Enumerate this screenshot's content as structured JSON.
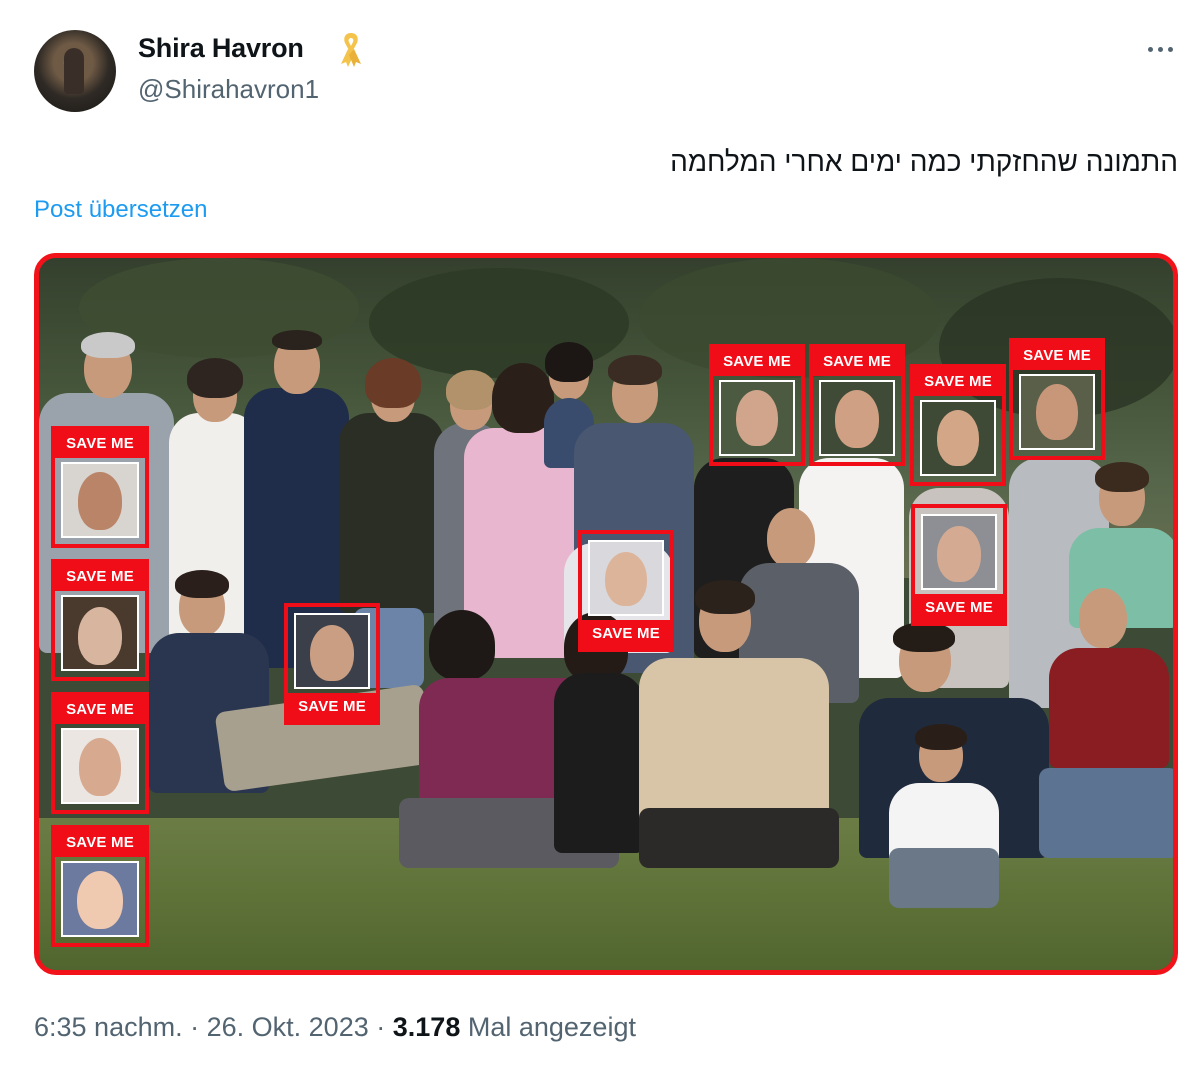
{
  "author": {
    "display_name": "Shira Havron",
    "handle": "@Shirahavron1",
    "badge": "ribbon-icon",
    "badge_color": "#f4c34c"
  },
  "tweet": {
    "text": "התמונה שהחזקתי כמה ימים אחרי המלחמה",
    "translate_label": "Post übersetzen"
  },
  "media": {
    "border_color": "#f2121a",
    "overlay_label": "SAVE ME",
    "overlays": [
      {
        "label": "SAVE ME"
      },
      {
        "label": "SAVE ME"
      },
      {
        "label": "SAVE ME"
      },
      {
        "label": "SAVE ME"
      },
      {
        "label": "SAVE ME"
      },
      {
        "label": "SAVE ME"
      },
      {
        "label": "SAVE ME"
      },
      {
        "label": "SAVE ME"
      },
      {
        "label": "SAVE ME"
      },
      {
        "label": "SAVE ME"
      },
      {
        "label": "SAVE ME"
      },
      {
        "label": "SAVE ME"
      },
      {
        "label": "SAVE ME"
      }
    ]
  },
  "footer": {
    "time": "6:35 nachm.",
    "separator": "·",
    "date": "26. Okt. 2023",
    "views_count": "3.178",
    "views_label": "Mal angezeigt"
  },
  "colors": {
    "link": "#1d9bf0",
    "secondary_text": "#536471",
    "save_red": "#f00d18"
  }
}
